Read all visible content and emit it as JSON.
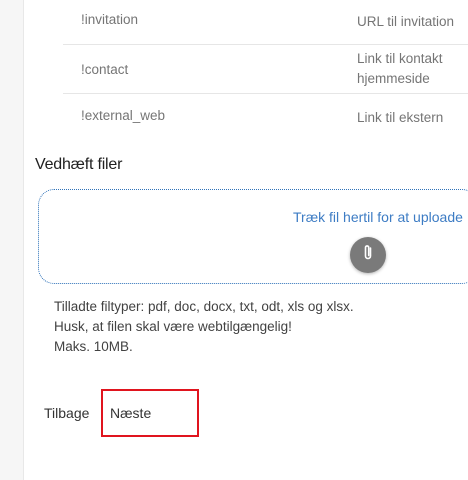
{
  "variables": [
    {
      "code": "!invitation",
      "description": "URL til invitation"
    },
    {
      "code": "!contact",
      "description": "Link til kontakt hjemmeside"
    },
    {
      "code": "!external_web",
      "description": "Link til ekstern"
    }
  ],
  "attachments": {
    "title": "Vedhæft filer",
    "dropzone_text": "Træk fil hertil for at uploade",
    "upload_icon": "paperclip-icon",
    "info_lines": [
      "Tilladte filtyper: pdf, doc, docx, txt, odt, xls og xlsx.",
      "Husk, at filen skal være webtilgængelig!",
      "Maks. 10MB."
    ]
  },
  "nav": {
    "back_label": "Tilbage",
    "next_label": "Næste",
    "highlight_color": "#e0141e"
  }
}
